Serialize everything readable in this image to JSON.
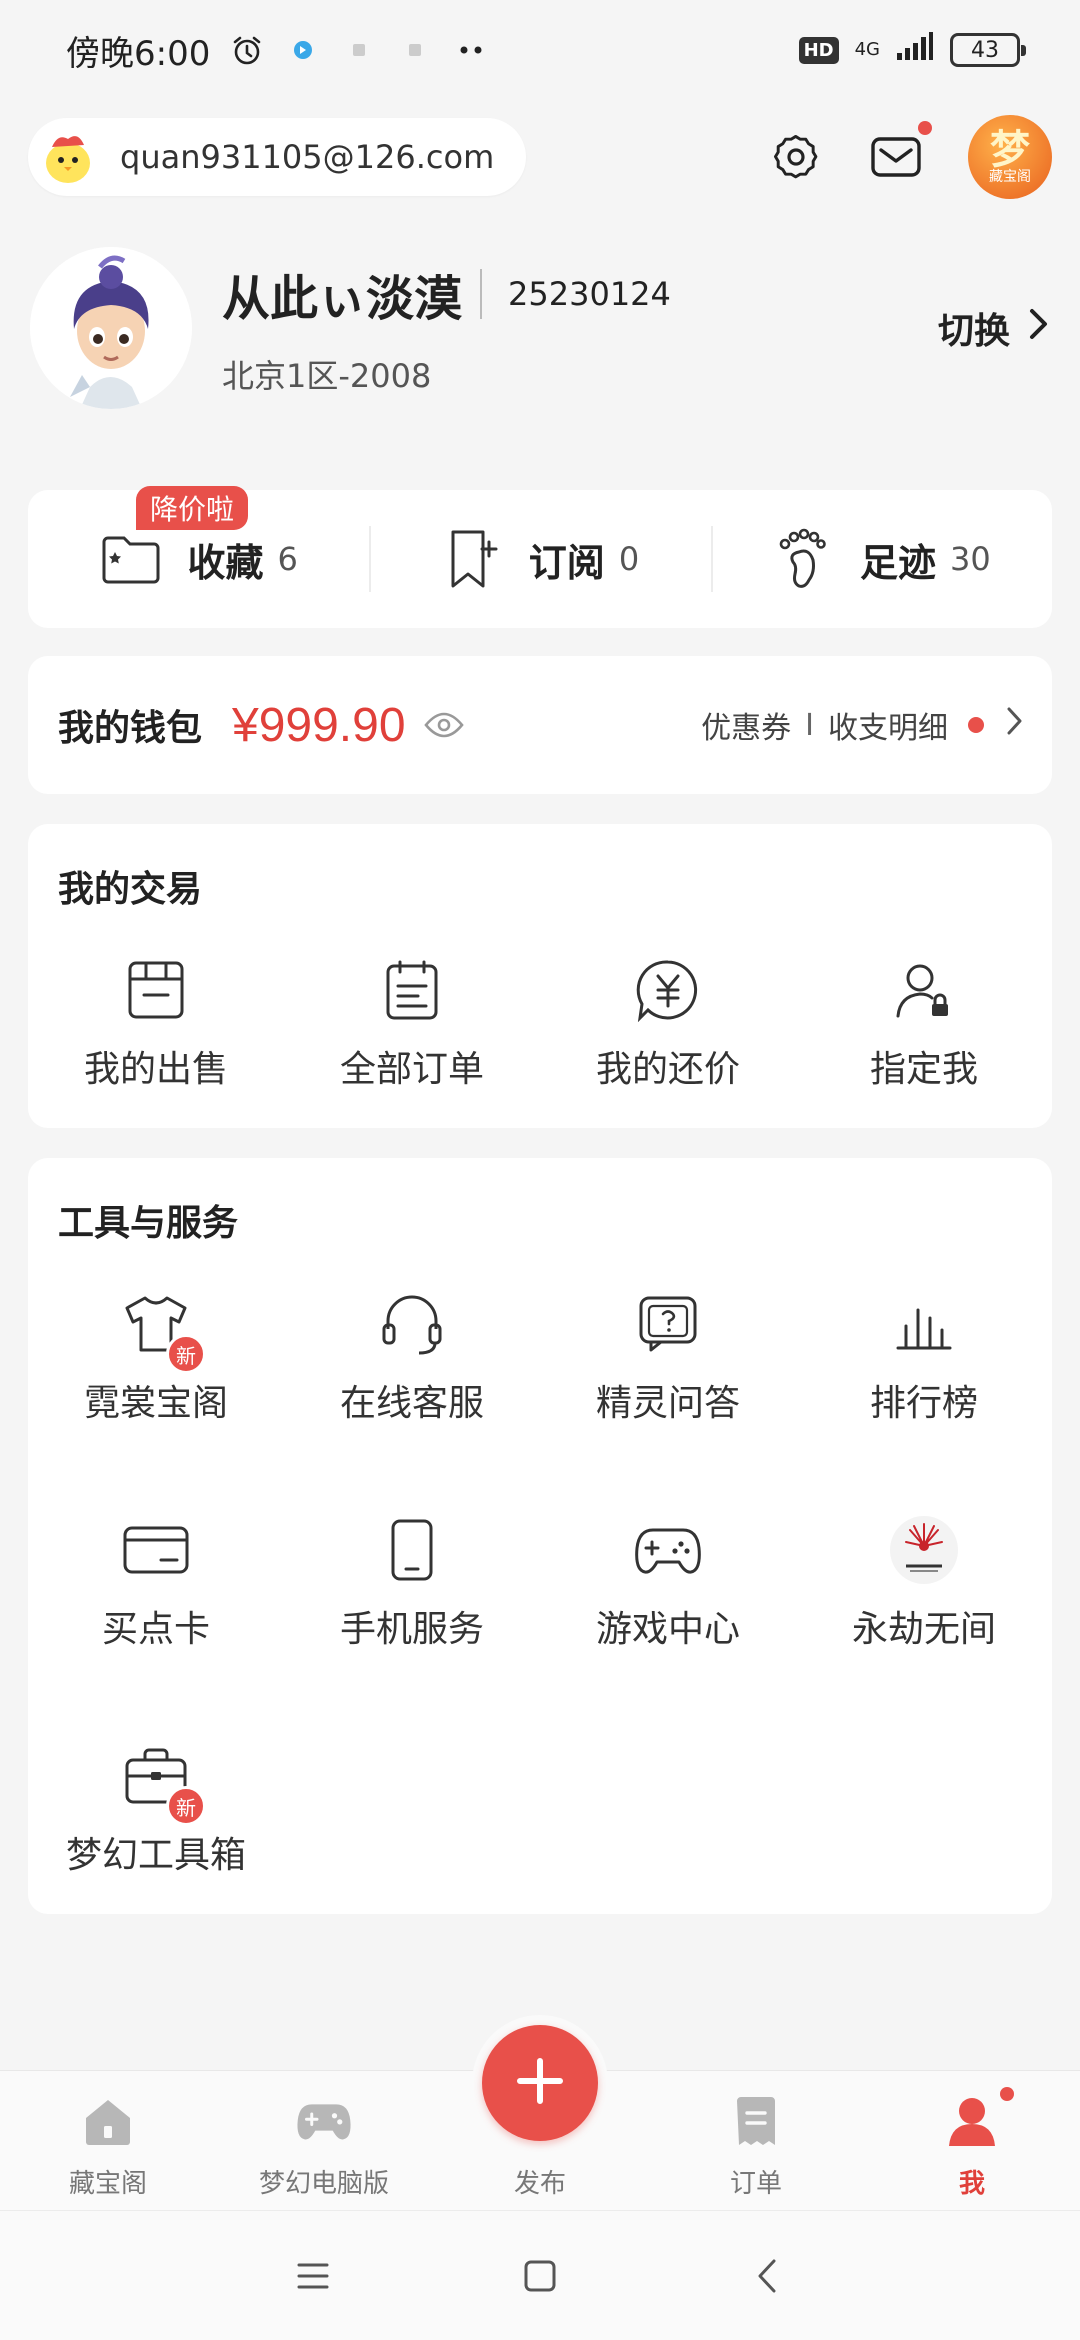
{
  "status_bar": {
    "time": "傍晚6:00",
    "hd": "HD",
    "network": "4G",
    "battery": "43"
  },
  "account": {
    "email": "quan931105@126.com"
  },
  "app_logo": {
    "big_char": "梦",
    "small_text": "藏宝阁"
  },
  "profile": {
    "nickname": "从此ぃ淡漠",
    "user_id": "25230124",
    "server": "北京1区-2008",
    "switch_label": "切换"
  },
  "stats": {
    "badge": "降价啦",
    "items": [
      {
        "label": "收藏",
        "count": "6"
      },
      {
        "label": "订阅",
        "count": "0"
      },
      {
        "label": "足迹",
        "count": "30"
      }
    ]
  },
  "wallet": {
    "title": "我的钱包",
    "amount": "¥999.90",
    "coupon": "优惠券",
    "separator": "I",
    "details": "收支明细"
  },
  "trade": {
    "title": "我的交易",
    "items": [
      {
        "label": "我的出售",
        "icon": "shop-icon"
      },
      {
        "label": "全部订单",
        "icon": "order-list-icon"
      },
      {
        "label": "我的还价",
        "icon": "yen-icon"
      },
      {
        "label": "指定我",
        "icon": "user-lock-icon"
      }
    ]
  },
  "tools": {
    "title": "工具与服务",
    "new_badge": "新",
    "items": [
      {
        "label": "霓裳宝阁",
        "icon": "shirt-icon"
      },
      {
        "label": "在线客服",
        "icon": "headset-icon"
      },
      {
        "label": "精灵问答",
        "icon": "question-icon"
      },
      {
        "label": "排行榜",
        "icon": "ranking-icon"
      },
      {
        "label": "买点卡",
        "icon": "card-icon"
      },
      {
        "label": "手机服务",
        "icon": "phone-icon"
      },
      {
        "label": "游戏中心",
        "icon": "gamepad-icon"
      },
      {
        "label": "永劫无间",
        "icon": "naraka-logo-icon"
      },
      {
        "label": "梦幻工具箱",
        "icon": "toolbox-icon"
      }
    ]
  },
  "bottom_nav": {
    "items": [
      {
        "label": "藏宝阁",
        "icon": "home-icon"
      },
      {
        "label": "梦幻电脑版",
        "icon": "gamepad-icon"
      },
      {
        "label": "发布",
        "icon": "plus-icon"
      },
      {
        "label": "订单",
        "icon": "order-icon"
      },
      {
        "label": "我",
        "icon": "user-icon"
      }
    ],
    "active": "我"
  },
  "colors": {
    "accent_red": "#e8504a",
    "price_red": "#e0403a",
    "background": "#f5f5f5"
  }
}
